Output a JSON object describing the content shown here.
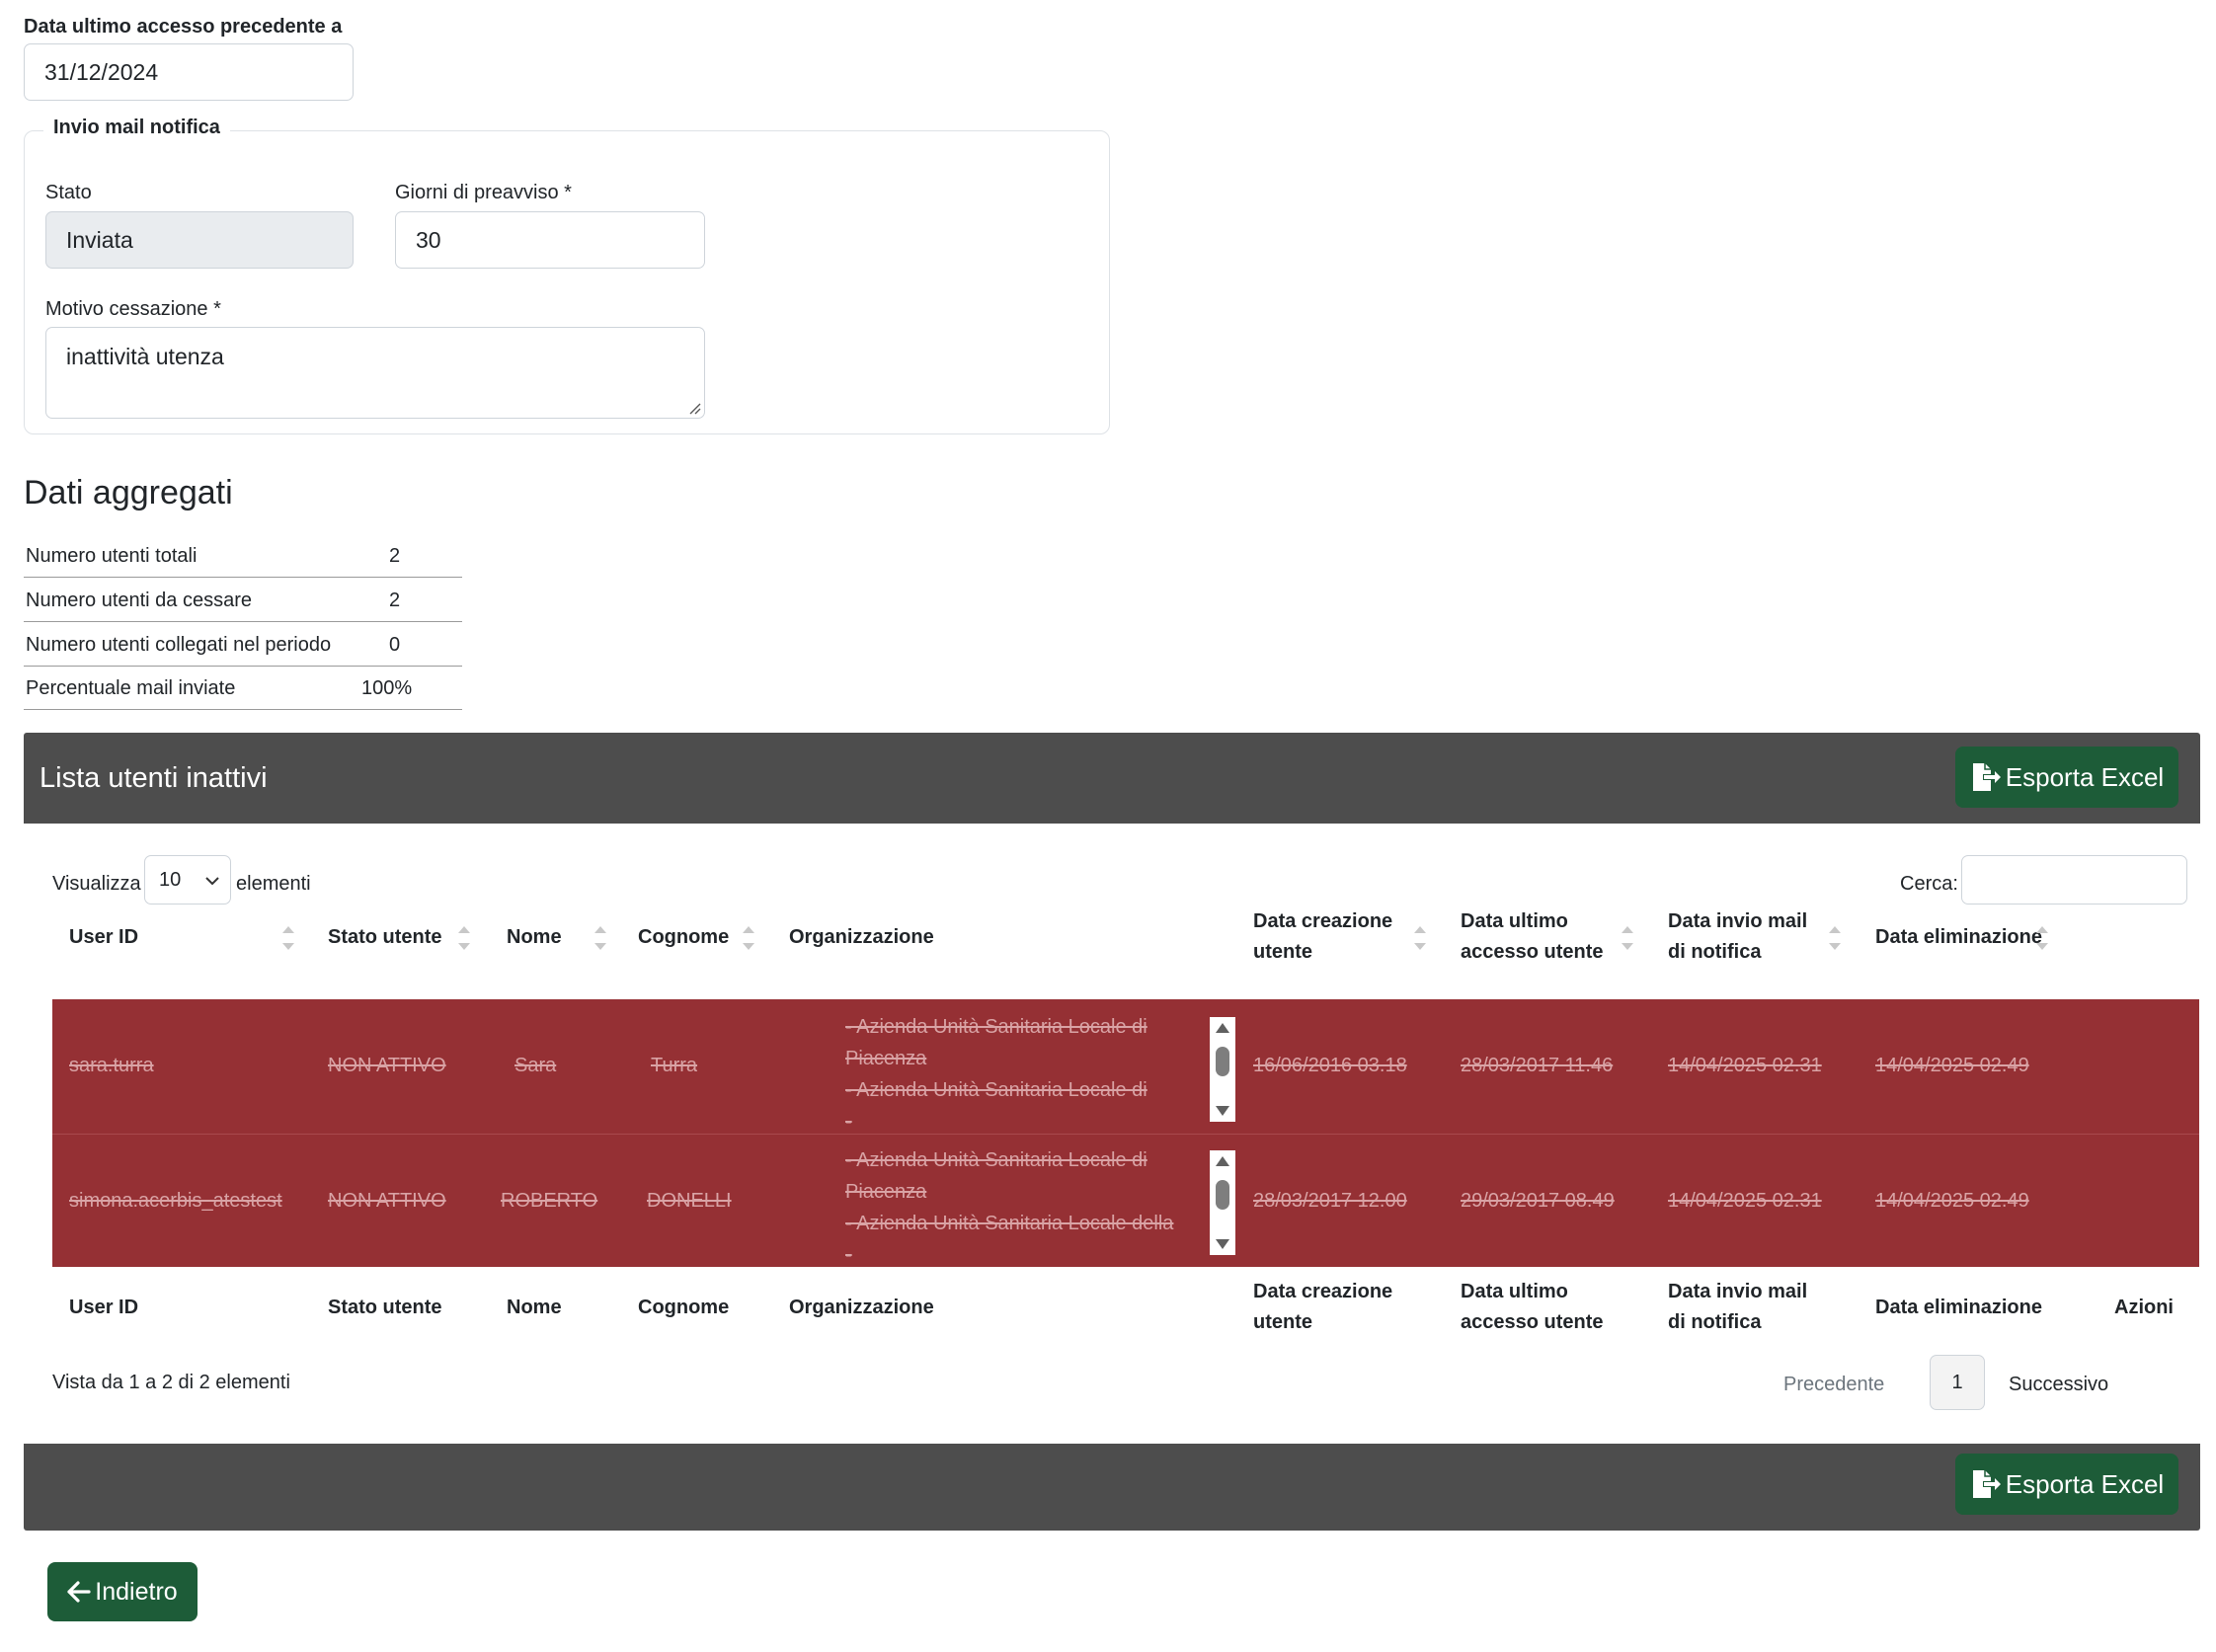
{
  "form": {
    "last_access_label": "Data ultimo accesso precedente a",
    "last_access_value": "31/12/2024",
    "fieldset_legend": "Invio mail notifica",
    "stato_label": "Stato",
    "stato_value": "Inviata",
    "giorni_label": "Giorni di preavviso *",
    "giorni_value": "30",
    "motivo_label": "Motivo cessazione *",
    "motivo_value": "inattività utenza"
  },
  "aggregati": {
    "title": "Dati aggregati",
    "rows": [
      {
        "label": "Numero utenti totali",
        "value": "2"
      },
      {
        "label": "Numero utenti da cessare",
        "value": "2"
      },
      {
        "label": "Numero utenti collegati nel periodo",
        "value": "0"
      },
      {
        "label": "Percentuale mail inviate",
        "value": "100%"
      }
    ]
  },
  "panel": {
    "title": "Lista utenti inattivi",
    "export_label": "Esporta Excel",
    "show_label": "Visualizza",
    "show_value": "10",
    "show_suffix": "elementi",
    "search_label": "Cerca:",
    "columns": {
      "user_id": "User ID",
      "stato": "Stato utente",
      "nome": "Nome",
      "cognome": "Cognome",
      "org": "Organizzazione",
      "creazione_1": "Data creazione",
      "creazione_2": "utente",
      "accesso_1": "Data ultimo",
      "accesso_2": "accesso utente",
      "invio_1": "Data invio mail",
      "invio_2": "di notifica",
      "eliminazione": "Data eliminazione",
      "azioni": "Azioni"
    },
    "rows": [
      {
        "user_id": "sara.turra",
        "stato": "NON ATTIVO",
        "nome": "Sara",
        "cognome": "Turra",
        "org_lines": [
          "- Azienda Unità Sanitaria Locale di",
          "Piacenza",
          "- Azienda Unità Sanitaria Locale di",
          "-"
        ],
        "creazione": "16/06/2016 03.18",
        "accesso": "28/03/2017 11.46",
        "invio": "14/04/2025 02.31",
        "eliminazione": "14/04/2025 02.49"
      },
      {
        "user_id": "simona.acerbis_atestest",
        "stato": "NON ATTIVO",
        "nome": "ROBERTO",
        "cognome": "DONELLI",
        "org_lines": [
          "- Azienda Unità Sanitaria Locale di",
          "Piacenza",
          "- Azienda Unità Sanitaria Locale della",
          "-"
        ],
        "creazione": "28/03/2017 12.00",
        "accesso": "29/03/2017 08.49",
        "invio": "14/04/2025 02.31",
        "eliminazione": "14/04/2025 02.49"
      }
    ],
    "info": "Vista da 1 a 2 di 2 elementi",
    "prev": "Precedente",
    "page": "1",
    "next": "Successivo"
  },
  "back_label": "Indietro",
  "colors": {
    "accent_green": "#1d5c38",
    "row_red": "#953034",
    "panel_dark": "#4d4d4d"
  }
}
